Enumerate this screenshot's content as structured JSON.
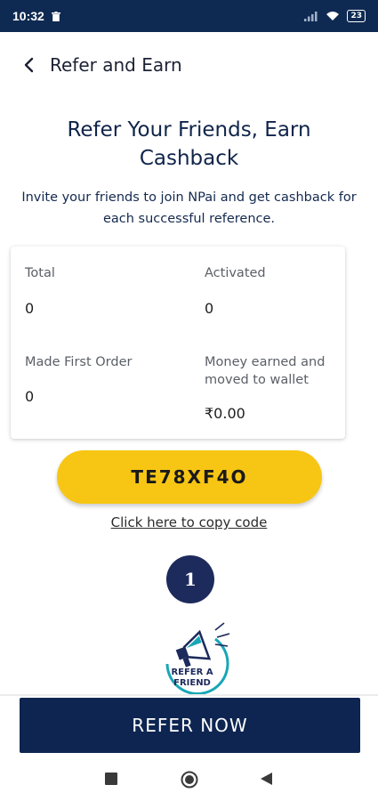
{
  "status_bar": {
    "time": "10:32",
    "battery": "23"
  },
  "header": {
    "title": "Refer and Earn"
  },
  "hero": {
    "title_line1": "Refer Your Friends, Earn",
    "title_line2": "Cashback",
    "subtitle_line1": "Invite your friends to join NPai and get cashback for",
    "subtitle_line2": "each successful reference."
  },
  "stats": {
    "total_label": "Total",
    "total_value": "0",
    "activated_label": "Activated",
    "activated_value": "0",
    "first_order_label": "Made First Order",
    "first_order_value": "0",
    "money_label_line1": "Money earned and",
    "money_label_line2": "moved to wallet",
    "money_value": "₹0.00"
  },
  "referral": {
    "code": "TE78XF4O",
    "copy_link": "Click here to copy code"
  },
  "steps": {
    "step_number": "1",
    "illustration_line1": "REFER A",
    "illustration_line2": "FRIEND"
  },
  "cta": {
    "label": "REFER NOW"
  },
  "colors": {
    "primary": "#0d2550",
    "accent": "#f7c614",
    "status_bar": "#0f2a52"
  },
  "icons": [
    "trash-icon",
    "signal-icon",
    "wifi-icon",
    "battery-icon",
    "back-arrow-icon",
    "megaphone-icon",
    "square-nav-icon",
    "home-nav-icon",
    "back-nav-icon"
  ]
}
